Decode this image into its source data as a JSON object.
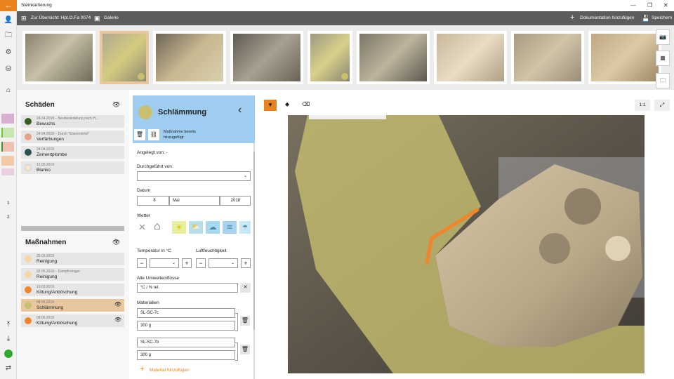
{
  "app": {
    "title": "Steinkartierung"
  },
  "toolbar": {
    "overview_label": "Zur Übersicht: Hpt.O.Fa 0074",
    "gallery_label": "Galerie",
    "add_doc_label": "Dokumentation hinzufügen",
    "save_label": "Speichern"
  },
  "sidebar": {
    "page1": "1",
    "page2": "2"
  },
  "damages": {
    "title": "Schäden",
    "items": [
      {
        "date": "24.04.2018 – Neubesiedelung nach H...",
        "name": "Bewuchs",
        "color": "#3b5e1e"
      },
      {
        "date": "24.04.2018 – Durch \"Eisenmörtel\"",
        "name": "Verfärbungen",
        "color": "#e8a08a"
      },
      {
        "date": "24.04.2018",
        "name": "Zementplombe",
        "color": "#2f4f4f"
      },
      {
        "date": "10.05.2019",
        "name": "Blanko",
        "color": "#f5e6d3"
      }
    ]
  },
  "measures": {
    "title": "Maßnahmen",
    "items": [
      {
        "date": "25.03.2019",
        "name": "Reinigung",
        "color": "#f5d6a8"
      },
      {
        "date": "02.05.2018 – Dampfreiniger",
        "name": "Reinigung",
        "color": "#f5d6a8"
      },
      {
        "date": "19.03.2019",
        "name": "Kittung/Anböschung",
        "color": "#f0862a"
      },
      {
        "date": "08.05.2018",
        "name": "Schlämmung",
        "color": "#c8c070"
      },
      {
        "date": "08.05.2018",
        "name": "Kittung/Anböschung",
        "color": "#f0862a"
      }
    ]
  },
  "form": {
    "title": "Schlämmung",
    "status_line1": "Maßnahme bereits",
    "status_line2": "hinzugefügt",
    "created_by": "Angelegt von: -",
    "performed_by_label": "Durchgeführt von:",
    "date_label": "Datum",
    "day": "8",
    "month": "Mai",
    "year": "2018",
    "weather_label": "Wetter",
    "temp_label": "Temperatur in °C",
    "humidity_label": "Luftfeuchtigkeit",
    "env_label": "Alle Umwelteinflüsse",
    "env_value": "°C / % rel.",
    "materials_label": "Materialien",
    "materials": [
      {
        "name": "SL-SC-7c",
        "amount": "300 g"
      },
      {
        "name": "SL-SC-7b",
        "amount": "300 g"
      }
    ],
    "add_material": "Material hinzufügen",
    "accent": "#e8821e"
  },
  "viewer": {
    "zoom_label": "1:1"
  }
}
